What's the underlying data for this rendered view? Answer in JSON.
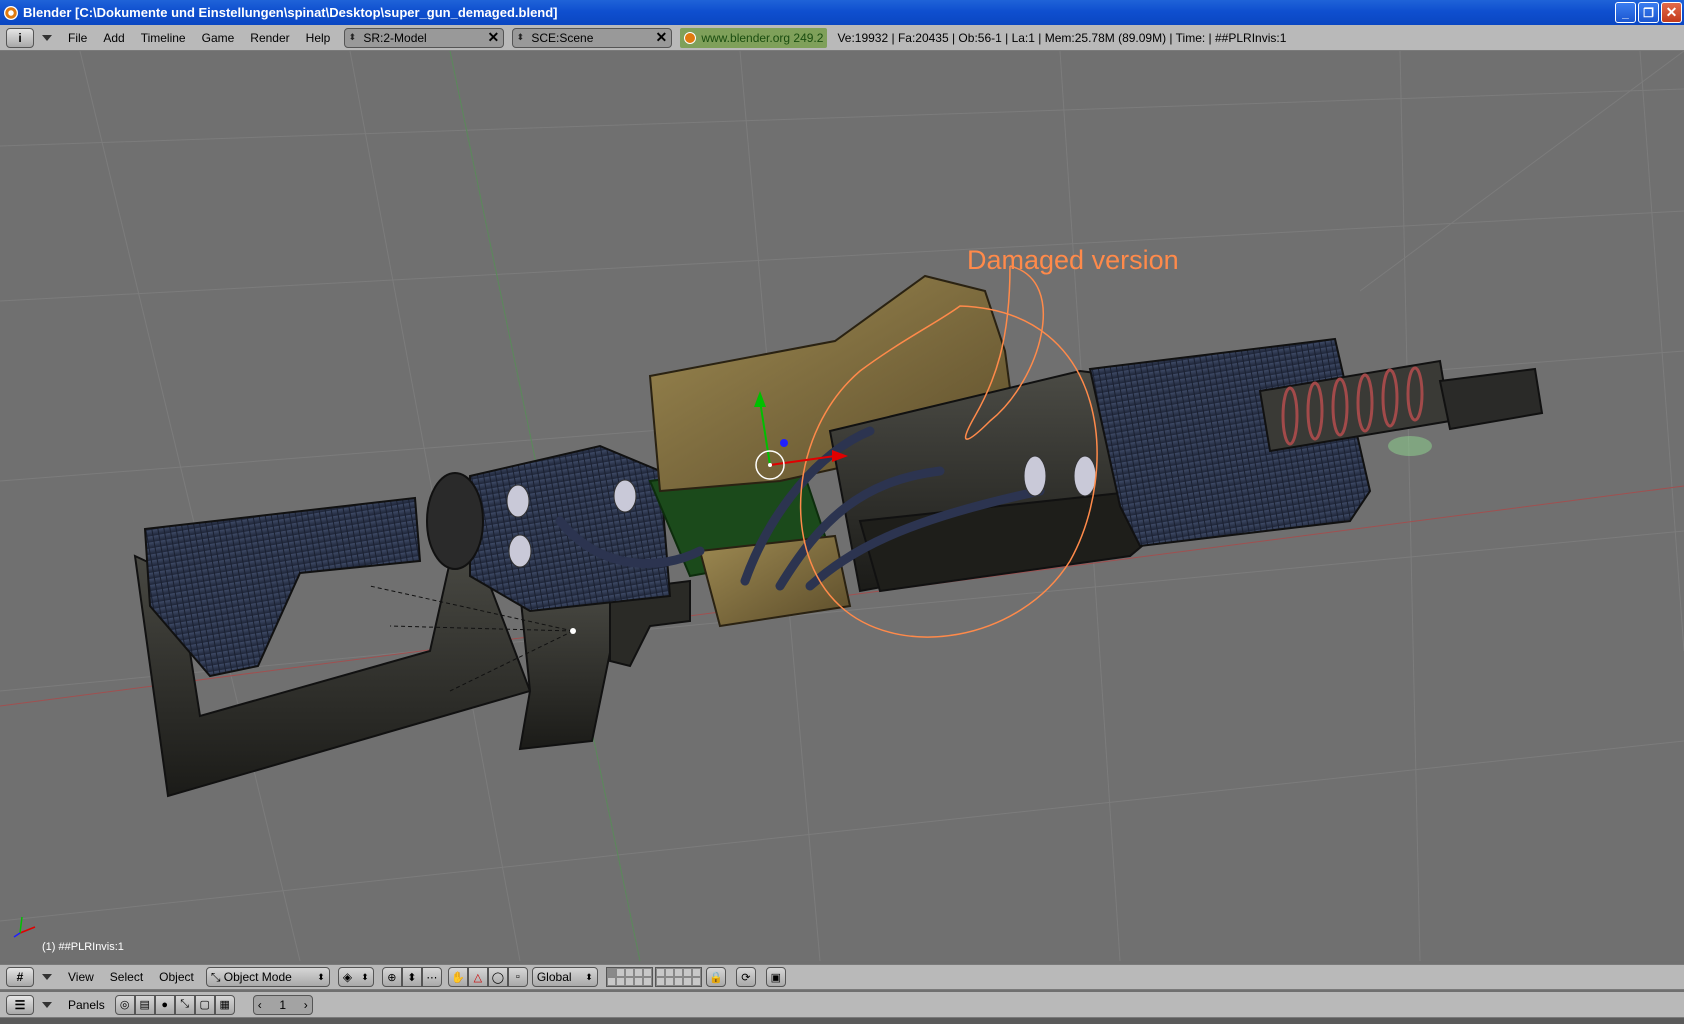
{
  "window": {
    "title": "Blender [C:\\Dokumente und Einstellungen\\spinat\\Desktop\\super_gun_demaged.blend]",
    "minimize_glyph": "_",
    "restore_glyph": "❐",
    "close_glyph": "✕"
  },
  "top_header": {
    "info_icon": "i",
    "menu": [
      "File",
      "Add",
      "Timeline",
      "Game",
      "Render",
      "Help"
    ],
    "screen_field": "SR:2-Model",
    "scene_field": "SCE:Scene",
    "blender_link": "www.blender.org 249.2",
    "stats": "Ve:19932 | Fa:20435 | Ob:56-1 | La:1  | Mem:25.78M (89.09M)  | Time: | ##PLRInvis:1"
  },
  "viewport": {
    "annotation": "Damaged version",
    "object_label": "(1) ##PLRInvis:1",
    "annotation_color": "#ff8a4a"
  },
  "view_header": {
    "menu": [
      "View",
      "Select",
      "Object"
    ],
    "mode": "Object Mode",
    "orientation": "Global"
  },
  "panel_header": {
    "label": "Panels",
    "frame": "1"
  }
}
